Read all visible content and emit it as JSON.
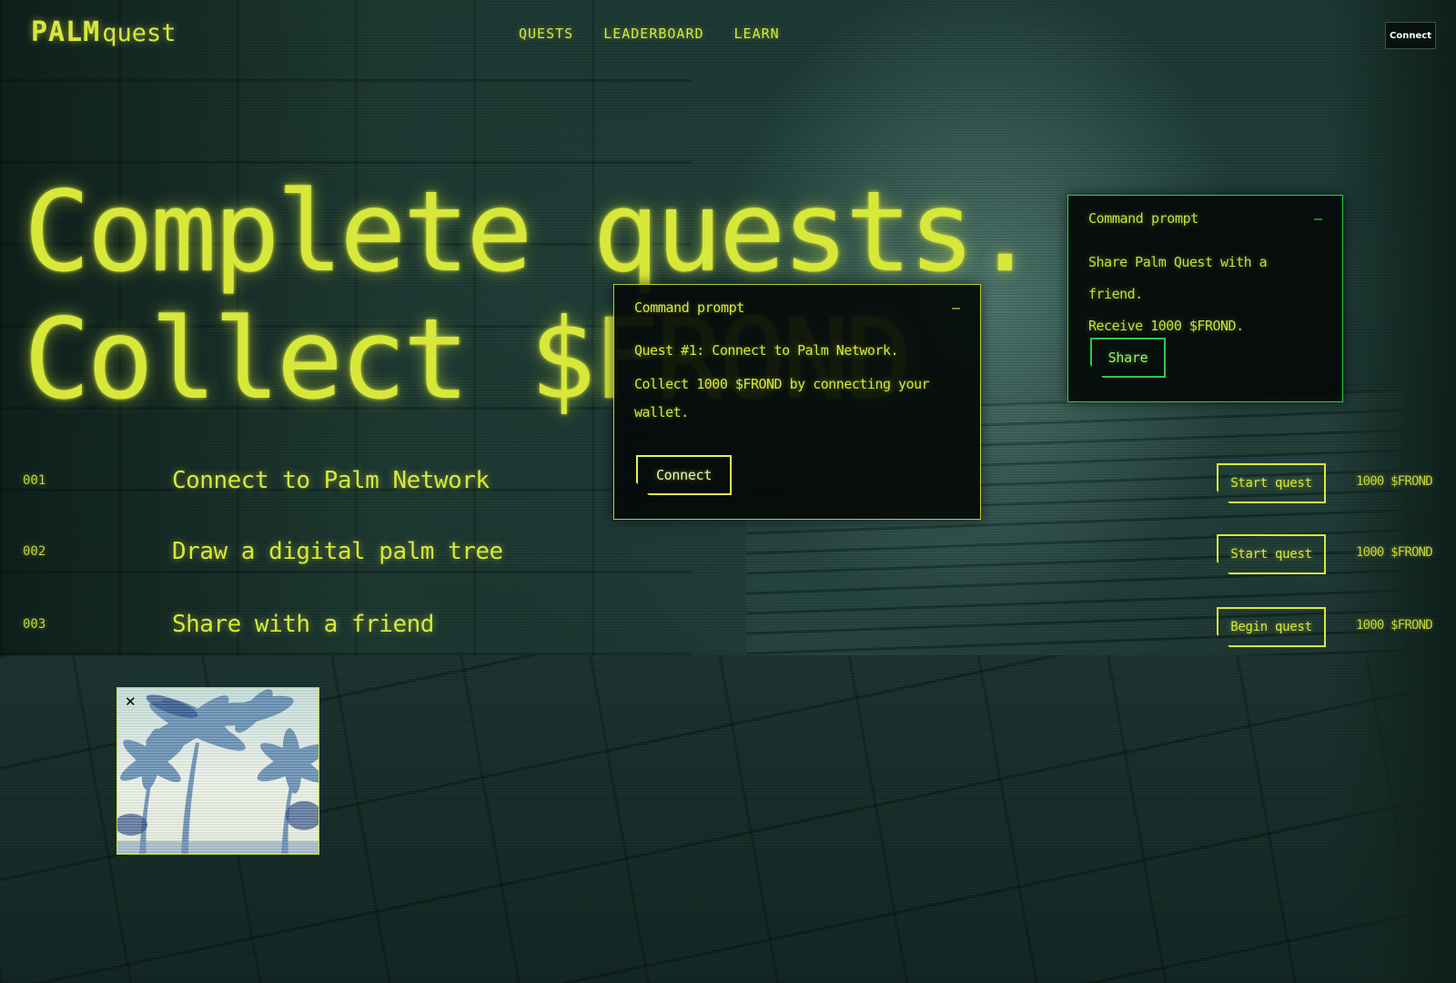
{
  "header": {
    "logo_mark": "PALM",
    "logo_word": "quest",
    "nav": [
      "QUESTS",
      "LEADERBOARD",
      "LEARN"
    ],
    "connect_label": "Connect"
  },
  "hero": {
    "line1": "Complete quests.",
    "line2": "Collect $FROND"
  },
  "quests": [
    {
      "num": "001",
      "title": "Connect to Palm Network",
      "button": "Start quest",
      "reward": "1000 $FROND"
    },
    {
      "num": "002",
      "title": "Draw a digital palm tree",
      "button": "Start quest",
      "reward": "1000 $FROND"
    },
    {
      "num": "003",
      "title": "Share with a friend",
      "button": "Begin quest",
      "reward": "1000 $FROND"
    }
  ],
  "prompt_connect": {
    "title": "Command prompt",
    "minimize": "—",
    "line1": "Quest #1: Connect to Palm Network.",
    "line2": "Collect 1000 $FROND by connecting your wallet.",
    "button": "Connect"
  },
  "prompt_share": {
    "title": "Command prompt",
    "minimize": "—",
    "line1": "Share Palm Quest with a friend.",
    "line2": "Receive 1000 $FROND.",
    "button": "Share"
  },
  "palm_window": {
    "close": "✕",
    "image": "palm-trees-photo"
  },
  "colors": {
    "accent": "#d7e83a",
    "share_border": "#2ecc45",
    "panel_bg": "#040a09"
  }
}
